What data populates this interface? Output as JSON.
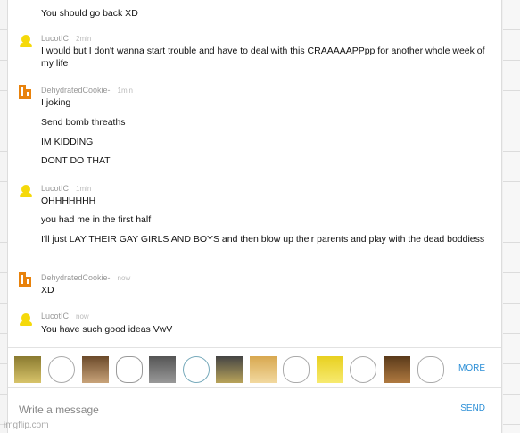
{
  "colors": {
    "accent": "#2a8ed6",
    "user_yellow": "#f5d90a",
    "user_orange": "#e8820c"
  },
  "messages": [
    {
      "lines": [
        "You should go back XD"
      ]
    },
    {
      "user": "LucotIC",
      "time": "2min",
      "avatar": "yellow-person-icon",
      "lines": [
        "I would but I don't wanna start trouble and have to deal with this CRAAAAAPPpp for another whole week of my life"
      ]
    },
    {
      "user": "DehydratedCookie-",
      "time": "1min",
      "avatar": "orange-logo-icon",
      "lines": [
        "I joking",
        "Send bomb threaths",
        "IM KIDDING",
        "DONT DO THAT"
      ]
    },
    {
      "user": "LucotIC",
      "time": "1min",
      "avatar": "yellow-person-icon",
      "lines": [
        "OHHHHHHH",
        "you had me in the first half",
        "I'll just LAY THEIR GAY GIRLS AND BOYS and then blow up their parents and play with the dead boddiess"
      ]
    },
    {
      "user": "DehydratedCookie-",
      "time": "now",
      "avatar": "orange-logo-icon",
      "lines": [
        "XD"
      ]
    },
    {
      "user": "LucotIC",
      "time": "now",
      "avatar": "yellow-person-icon",
      "lines": [
        "You have such good ideas VwV"
      ]
    }
  ],
  "emoji_bar": {
    "items": [
      "cat-meme-icon",
      "rage-face-icon",
      "jesus-icon",
      "troll-face-icon",
      "grumpy-cat-icon",
      "happy-tears-face-icon",
      "deal-with-it-icon",
      "doge-icon",
      "crying-face-icon",
      "spongebob-icon",
      "poker-face-icon",
      "man-face-icon",
      "okay-face-icon"
    ],
    "more_label": "MORE"
  },
  "composer": {
    "placeholder": "Write a message",
    "send_label": "SEND"
  },
  "watermark": "imgflip.com"
}
